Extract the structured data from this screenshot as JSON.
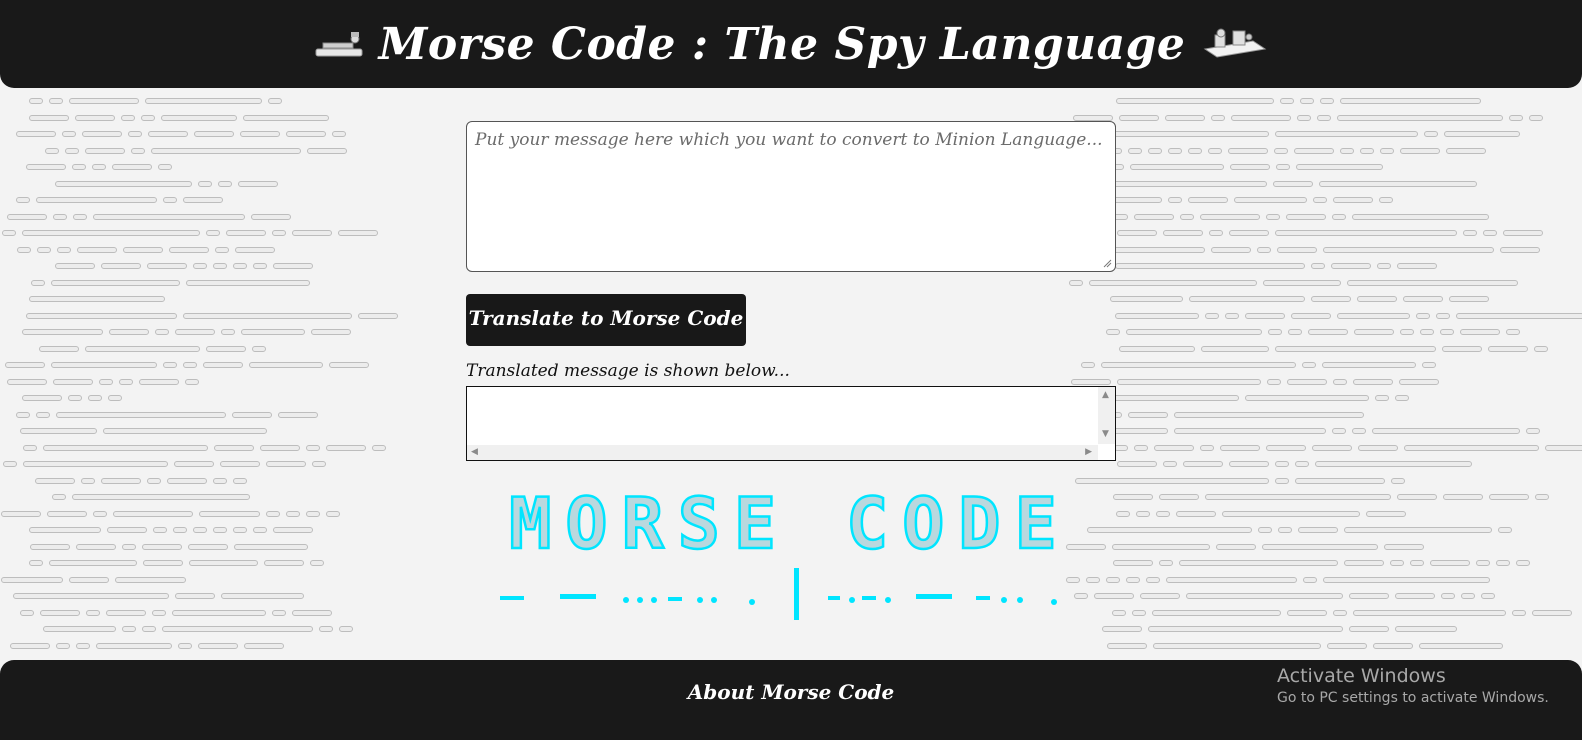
{
  "header": {
    "title": "Morse Code : The Spy Language",
    "left_icon": "telegraph-key-icon",
    "right_icon": "telegraph-machine-icon"
  },
  "translator": {
    "input_placeholder": "Put your message here which you want to convert to Minion Language...",
    "input_value": "",
    "button_label": "Translate to Morse Code",
    "output_label": "Translated message is shown below...",
    "output_value": ""
  },
  "logo": {
    "text": "MORSE CODE",
    "accent_color": "#00e5ff"
  },
  "footer": {
    "heading": "About Morse Code"
  },
  "system_watermark": {
    "title": "Activate Windows",
    "subtitle": "Go to PC settings to activate Windows."
  },
  "colors": {
    "header_bg": "#191919",
    "page_bg": "#f3f3f3",
    "button_bg": "#181818"
  }
}
